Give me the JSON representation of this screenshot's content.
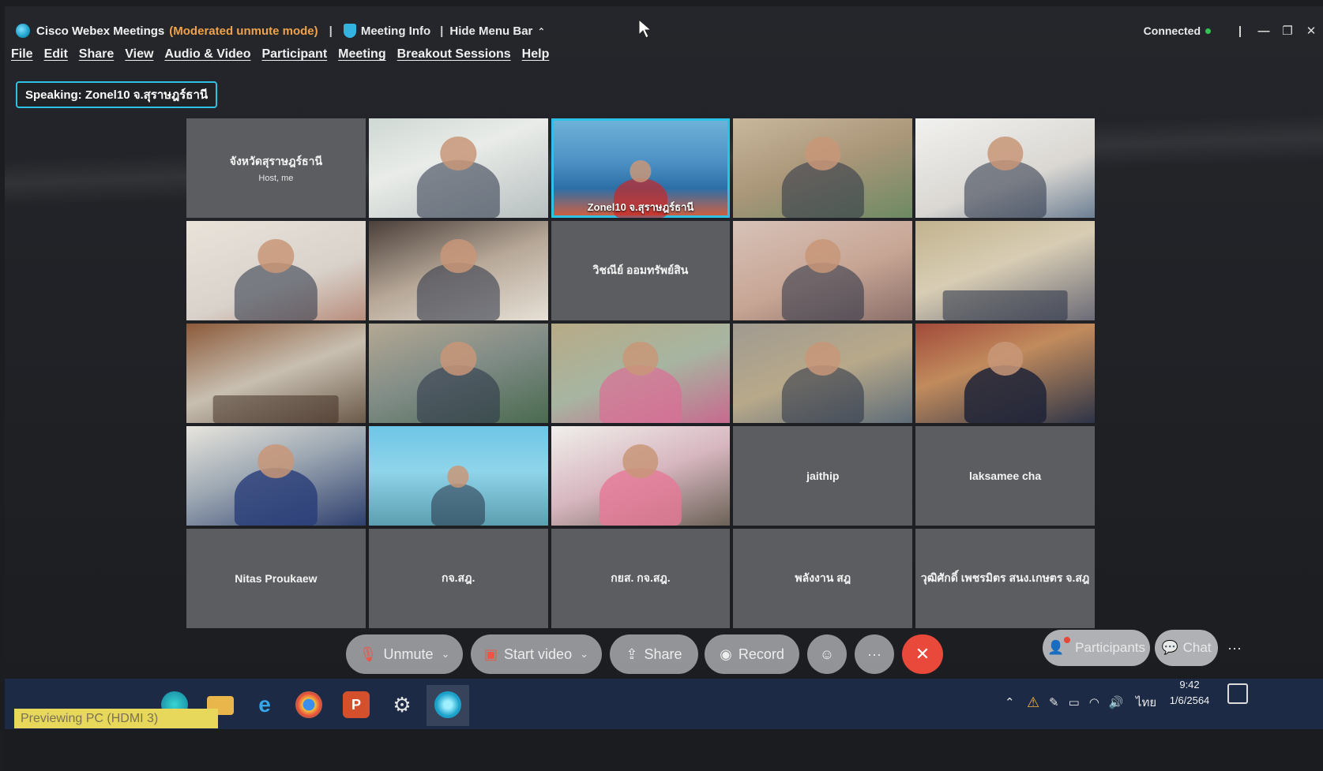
{
  "titlebar": {
    "app_title": "Cisco Webex Meetings",
    "mode": "(Moderated unmute mode)",
    "meeting_info": "Meeting Info",
    "hide_menu_bar": "Hide Menu Bar",
    "connection_status": "Connected",
    "status_color": "#32c552"
  },
  "menu": [
    "File",
    "Edit",
    "Share",
    "View",
    "Audio & Video",
    "Participant",
    "Meeting",
    "Breakout Sessions",
    "Help"
  ],
  "speaking": "Speaking: Zonel10 จ.สุราษฎร์ธานี",
  "tiles": [
    {
      "name": "จังหวัดสุราษฎร์ธานี",
      "host": "Host, me",
      "video": false
    },
    {
      "video": true
    },
    {
      "video": true,
      "caption": "Zonel10 จ.สุราษฎร์ธานี",
      "active": true
    },
    {
      "video": true
    },
    {
      "video": true
    },
    {
      "video": true
    },
    {
      "video": true
    },
    {
      "name": "วิชณีย์ ออมทรัพย์สิน",
      "video": false
    },
    {
      "video": true
    },
    {
      "video": true
    },
    {
      "video": true
    },
    {
      "video": true
    },
    {
      "video": true
    },
    {
      "video": true
    },
    {
      "video": true
    },
    {
      "video": true
    },
    {
      "video": true
    },
    {
      "video": true
    },
    {
      "name": "jaithip",
      "video": false
    },
    {
      "name": "laksamee cha",
      "video": false
    },
    {
      "name": "Nitas Proukaew",
      "video": false
    },
    {
      "name": "กจ.สฎ.",
      "video": false
    },
    {
      "name": "กยส. กจ.สฎ.",
      "video": false
    },
    {
      "name": "พลังงาน สฎ",
      "video": false
    },
    {
      "name": "วุฒิศักดิ์ เพชรมิตร สนง.เกษตร จ.สฎ",
      "video": false
    }
  ],
  "controls": {
    "unmute": "Unmute",
    "start_video": "Start video",
    "share": "Share",
    "record": "Record",
    "end_color": "#e8493a"
  },
  "side": {
    "participants": "Participants",
    "chat": "Chat"
  },
  "taskbar": {
    "preview": "Previewing PC (HDMI 3)",
    "language": "ไทย",
    "time": "9:42",
    "date": "1/6/2564"
  }
}
